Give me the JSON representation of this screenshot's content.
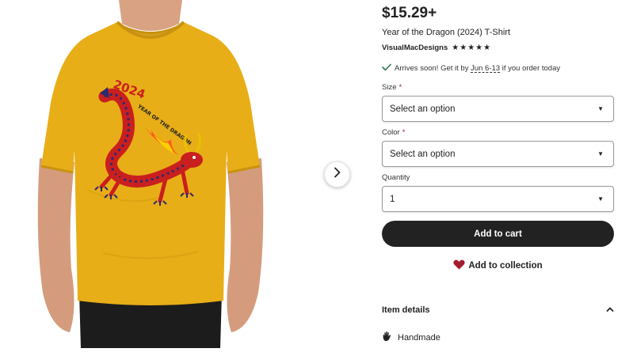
{
  "product": {
    "price": "$15.29+",
    "title": "Year of the Dragon (2024) T-Shirt",
    "shop_name": "VisualMacDesigns",
    "rating_stars": 5,
    "image": {
      "print_year": "2024",
      "print_caption": "YEAR OF THE DRAGON",
      "shirt_color": "#e8ae17"
    }
  },
  "shipping": {
    "prefix": "Arrives soon! Get it by ",
    "date_range": "Jun 6-13",
    "suffix": " if you order today"
  },
  "options": {
    "size": {
      "label": "Size",
      "required_mark": "*",
      "value": "Select an option"
    },
    "color": {
      "label": "Color",
      "required_mark": "*",
      "value": "Select an option"
    },
    "quantity": {
      "label": "Quantity",
      "value": "1"
    }
  },
  "actions": {
    "add_to_cart": "Add to cart",
    "add_to_collection": "Add to collection"
  },
  "details": {
    "heading": "Item details",
    "feature": "Handmade"
  },
  "colors": {
    "accent_dark": "#222222",
    "heart": "#a61a2e",
    "check": "#2f7a4b"
  }
}
